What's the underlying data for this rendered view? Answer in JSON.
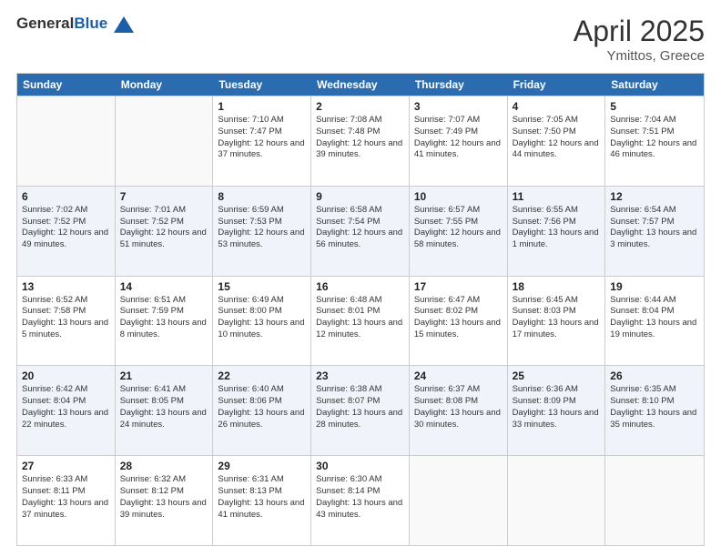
{
  "header": {
    "logo_general": "General",
    "logo_blue": "Blue",
    "month_year": "April 2025",
    "location": "Ymittos, Greece"
  },
  "calendar": {
    "days_of_week": [
      "Sunday",
      "Monday",
      "Tuesday",
      "Wednesday",
      "Thursday",
      "Friday",
      "Saturday"
    ],
    "rows": [
      [
        {
          "day": "",
          "content": ""
        },
        {
          "day": "",
          "content": ""
        },
        {
          "day": "1",
          "content": "Sunrise: 7:10 AM\nSunset: 7:47 PM\nDaylight: 12 hours and 37 minutes."
        },
        {
          "day": "2",
          "content": "Sunrise: 7:08 AM\nSunset: 7:48 PM\nDaylight: 12 hours and 39 minutes."
        },
        {
          "day": "3",
          "content": "Sunrise: 7:07 AM\nSunset: 7:49 PM\nDaylight: 12 hours and 41 minutes."
        },
        {
          "day": "4",
          "content": "Sunrise: 7:05 AM\nSunset: 7:50 PM\nDaylight: 12 hours and 44 minutes."
        },
        {
          "day": "5",
          "content": "Sunrise: 7:04 AM\nSunset: 7:51 PM\nDaylight: 12 hours and 46 minutes."
        }
      ],
      [
        {
          "day": "6",
          "content": "Sunrise: 7:02 AM\nSunset: 7:52 PM\nDaylight: 12 hours and 49 minutes."
        },
        {
          "day": "7",
          "content": "Sunrise: 7:01 AM\nSunset: 7:52 PM\nDaylight: 12 hours and 51 minutes."
        },
        {
          "day": "8",
          "content": "Sunrise: 6:59 AM\nSunset: 7:53 PM\nDaylight: 12 hours and 53 minutes."
        },
        {
          "day": "9",
          "content": "Sunrise: 6:58 AM\nSunset: 7:54 PM\nDaylight: 12 hours and 56 minutes."
        },
        {
          "day": "10",
          "content": "Sunrise: 6:57 AM\nSunset: 7:55 PM\nDaylight: 12 hours and 58 minutes."
        },
        {
          "day": "11",
          "content": "Sunrise: 6:55 AM\nSunset: 7:56 PM\nDaylight: 13 hours and 1 minute."
        },
        {
          "day": "12",
          "content": "Sunrise: 6:54 AM\nSunset: 7:57 PM\nDaylight: 13 hours and 3 minutes."
        }
      ],
      [
        {
          "day": "13",
          "content": "Sunrise: 6:52 AM\nSunset: 7:58 PM\nDaylight: 13 hours and 5 minutes."
        },
        {
          "day": "14",
          "content": "Sunrise: 6:51 AM\nSunset: 7:59 PM\nDaylight: 13 hours and 8 minutes."
        },
        {
          "day": "15",
          "content": "Sunrise: 6:49 AM\nSunset: 8:00 PM\nDaylight: 13 hours and 10 minutes."
        },
        {
          "day": "16",
          "content": "Sunrise: 6:48 AM\nSunset: 8:01 PM\nDaylight: 13 hours and 12 minutes."
        },
        {
          "day": "17",
          "content": "Sunrise: 6:47 AM\nSunset: 8:02 PM\nDaylight: 13 hours and 15 minutes."
        },
        {
          "day": "18",
          "content": "Sunrise: 6:45 AM\nSunset: 8:03 PM\nDaylight: 13 hours and 17 minutes."
        },
        {
          "day": "19",
          "content": "Sunrise: 6:44 AM\nSunset: 8:04 PM\nDaylight: 13 hours and 19 minutes."
        }
      ],
      [
        {
          "day": "20",
          "content": "Sunrise: 6:42 AM\nSunset: 8:04 PM\nDaylight: 13 hours and 22 minutes."
        },
        {
          "day": "21",
          "content": "Sunrise: 6:41 AM\nSunset: 8:05 PM\nDaylight: 13 hours and 24 minutes."
        },
        {
          "day": "22",
          "content": "Sunrise: 6:40 AM\nSunset: 8:06 PM\nDaylight: 13 hours and 26 minutes."
        },
        {
          "day": "23",
          "content": "Sunrise: 6:38 AM\nSunset: 8:07 PM\nDaylight: 13 hours and 28 minutes."
        },
        {
          "day": "24",
          "content": "Sunrise: 6:37 AM\nSunset: 8:08 PM\nDaylight: 13 hours and 30 minutes."
        },
        {
          "day": "25",
          "content": "Sunrise: 6:36 AM\nSunset: 8:09 PM\nDaylight: 13 hours and 33 minutes."
        },
        {
          "day": "26",
          "content": "Sunrise: 6:35 AM\nSunset: 8:10 PM\nDaylight: 13 hours and 35 minutes."
        }
      ],
      [
        {
          "day": "27",
          "content": "Sunrise: 6:33 AM\nSunset: 8:11 PM\nDaylight: 13 hours and 37 minutes."
        },
        {
          "day": "28",
          "content": "Sunrise: 6:32 AM\nSunset: 8:12 PM\nDaylight: 13 hours and 39 minutes."
        },
        {
          "day": "29",
          "content": "Sunrise: 6:31 AM\nSunset: 8:13 PM\nDaylight: 13 hours and 41 minutes."
        },
        {
          "day": "30",
          "content": "Sunrise: 6:30 AM\nSunset: 8:14 PM\nDaylight: 13 hours and 43 minutes."
        },
        {
          "day": "",
          "content": ""
        },
        {
          "day": "",
          "content": ""
        },
        {
          "day": "",
          "content": ""
        }
      ]
    ]
  }
}
